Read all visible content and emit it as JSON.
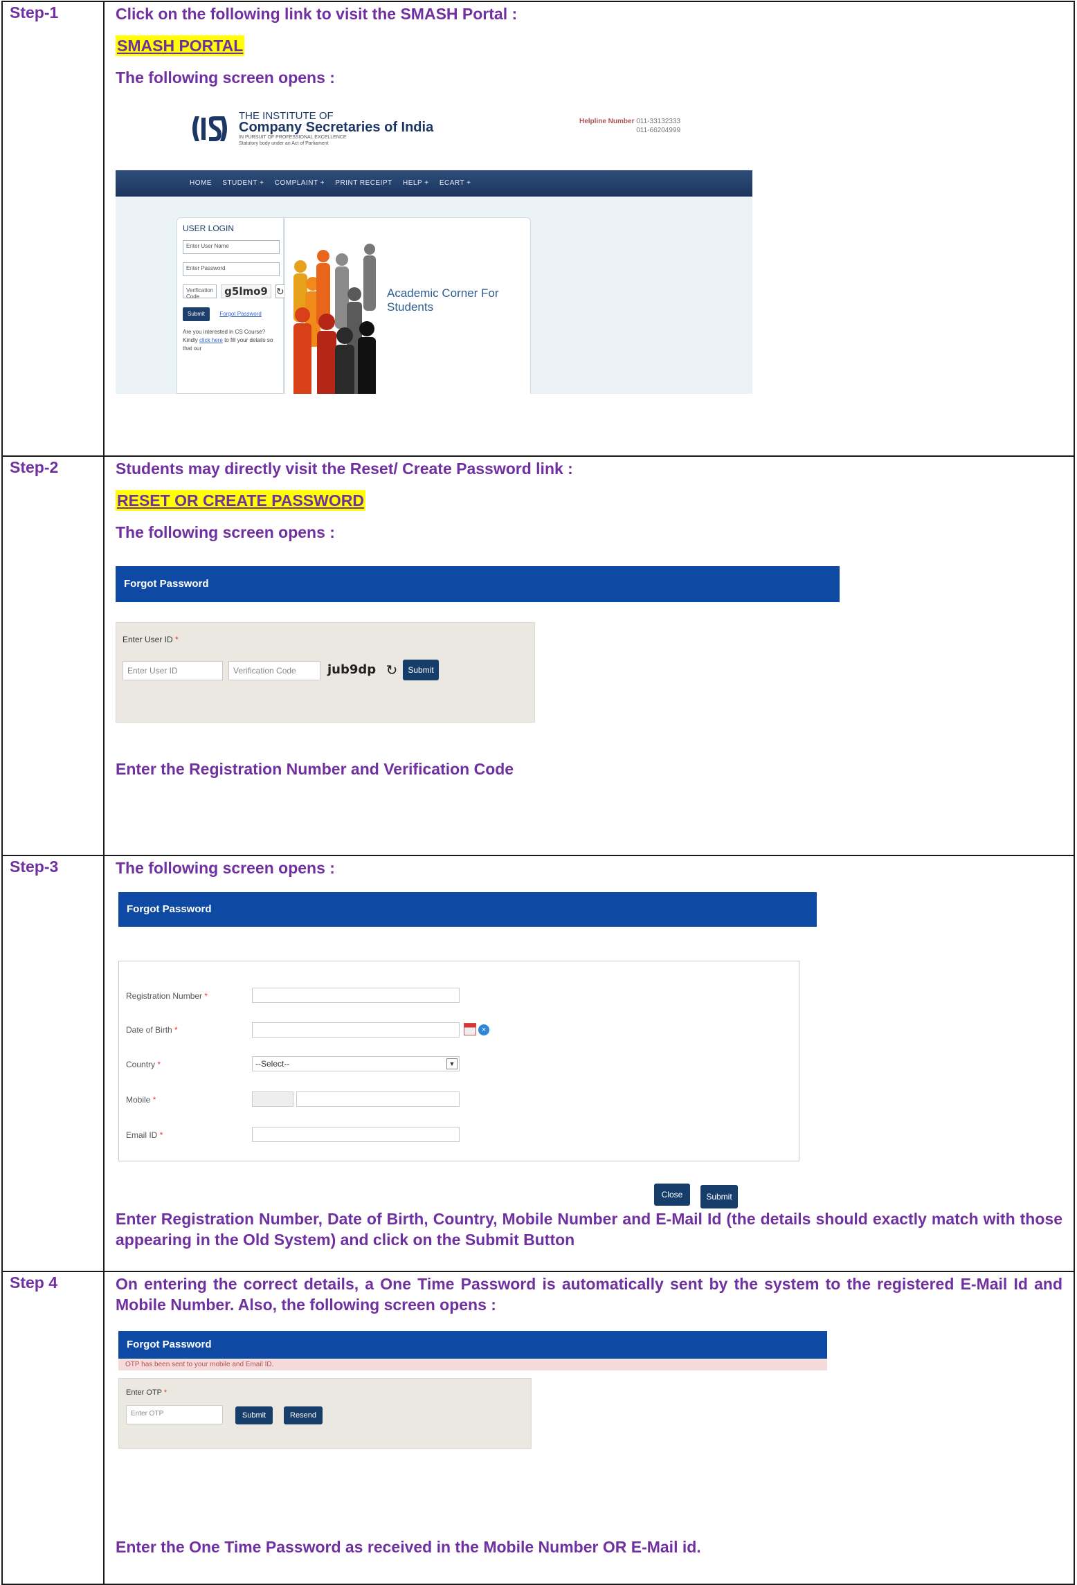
{
  "steps": [
    {
      "number": "Step-1",
      "intro": "Click on the following link to visit the SMASH Portal :",
      "link": "SMASH PORTAL",
      "screen_caption": "The following screen opens :",
      "screenshot": {
        "org_line1": "THE INSTITUTE OF",
        "org_line2": "Company Secretaries of India",
        "tagline": "IN PURSUIT OF PROFESSIONAL EXCELLENCE",
        "tagline2": "Statutory body under an Act of Parliament",
        "helpline_label": "Helpline Number",
        "helpline_1": "011-33132333",
        "helpline_2": "011-66204999",
        "nav": [
          "HOME",
          "STUDENT +",
          "COMPLAINT +",
          "PRINT RECEIPT",
          "HELP +",
          "ECART +"
        ],
        "login_title": "USER LOGIN",
        "username_placeholder": "Enter User Name",
        "password_placeholder": "Enter Password",
        "verification_placeholder": "Verification Code",
        "captcha": "g5lmo9",
        "submit": "Submit",
        "forgot": "Forgot Password",
        "promo_text": "Are you interested in CS Course? Kindly",
        "promo_link": "click here",
        "promo_rest": "to fill your details so that our",
        "banner_text": "Academic Corner For Students"
      }
    },
    {
      "number": "Step-2",
      "intro": "Students may directly visit the Reset/ Create Password link :",
      "link": "RESET OR CREATE PASSWORD",
      "screen_caption": "The following screen opens :",
      "screenshot": {
        "title": "Forgot Password",
        "field_label": "Enter User ID",
        "req": "*",
        "userid_placeholder": "Enter User ID",
        "verification_placeholder": "Verification Code",
        "captcha": "jub9dp",
        "submit": "Submit"
      },
      "outro": "Enter the Registration Number and Verification Code"
    },
    {
      "number": "Step-3",
      "intro": "The following screen opens :",
      "screenshot": {
        "title": "Forgot Password",
        "req": "*",
        "fields": {
          "registration": "Registration Number",
          "dob": "Date of Birth",
          "country": "Country",
          "mobile": "Mobile",
          "email": "Email ID"
        },
        "country_value": "--Select--",
        "close": "Close",
        "submit": "Submit"
      },
      "outro": "Enter Registration Number, Date of Birth, Country, Mobile Number and E-Mail Id (the details should exactly match with those appearing in the Old System) and click on the Submit Button"
    },
    {
      "number": "Step 4",
      "intro": "On entering the correct details, a One Time Password is automatically sent by the system to the registered E-Mail Id and Mobile Number. Also, the following screen opens :",
      "screenshot": {
        "title": "Forgot Password",
        "message": "OTP has been sent to your mobile and Email ID.",
        "field_label": "Enter OTP",
        "req": "*",
        "otp_placeholder": "Enter OTP",
        "submit": "Submit",
        "resend": "Resend"
      },
      "outro": "Enter the One Time Password as received in the Mobile Number OR E-Mail id."
    }
  ],
  "colors": {
    "text": "#7030a0",
    "highlight": "#ffff00",
    "bar": "#0e4aa4",
    "nav": "#1b365e"
  }
}
